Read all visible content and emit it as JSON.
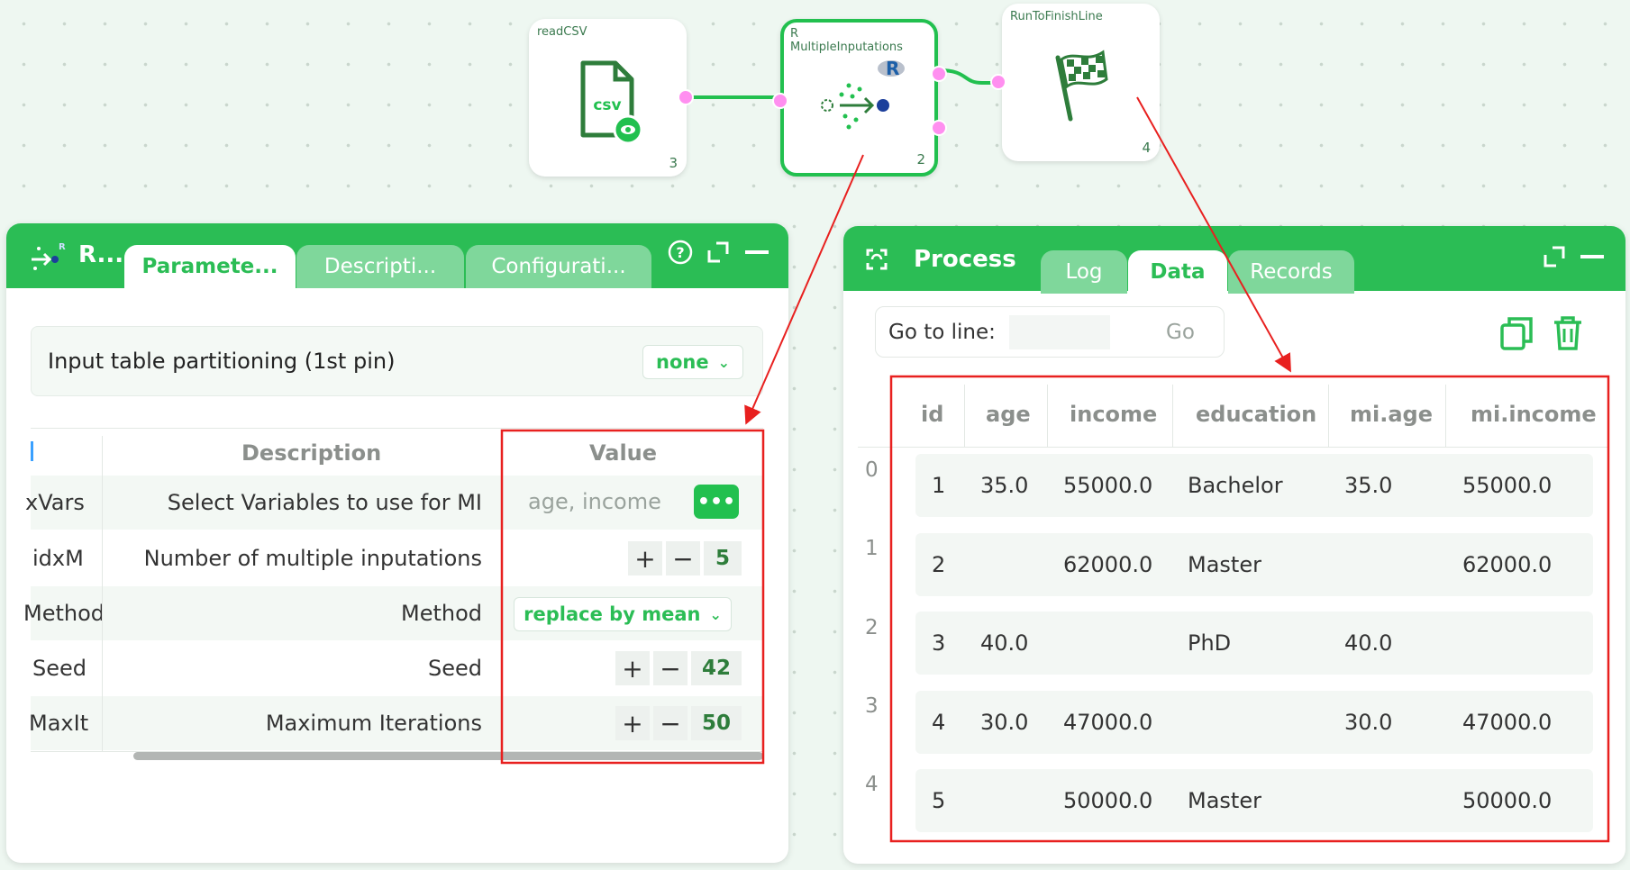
{
  "workflow": {
    "nodes": [
      {
        "title": "readCSV",
        "number": "3",
        "icon_label": "csv",
        "icon": "csv-file-icon"
      },
      {
        "title_line1": "R",
        "title_line2": "MultipleInputations",
        "number": "2",
        "badge": "R",
        "icon": "imputation-icon"
      },
      {
        "title": "RunToFinishLine",
        "number": "4",
        "icon": "checkered-flag-icon"
      }
    ]
  },
  "left_panel": {
    "title": "R...",
    "tabs": [
      {
        "label": "Paramete...",
        "active": true
      },
      {
        "label": "Descripti...",
        "active": false
      },
      {
        "label": "Configurati...",
        "active": false
      }
    ],
    "partition": {
      "label": "Input table partitioning (1st pin)",
      "value": "none"
    },
    "headers": {
      "description": "Description",
      "value": "Value"
    },
    "rows": [
      {
        "name": "xVars",
        "description": "Select Variables to use for MI",
        "value": "age, income",
        "control": "multiselect"
      },
      {
        "name": "idxM",
        "description": "Number of multiple inputations",
        "value": "5",
        "control": "stepper"
      },
      {
        "name": "Method",
        "description": "Method",
        "value": "replace by mean",
        "control": "select"
      },
      {
        "name": "Seed",
        "description": "Seed",
        "value": "42",
        "control": "stepper"
      },
      {
        "name": "MaxIt",
        "description": "Maximum Iterations",
        "value": "50",
        "control": "stepper"
      }
    ],
    "plus": "+",
    "minus": "−",
    "more": "•••"
  },
  "right_panel": {
    "title": "Process",
    "tabs": [
      {
        "label": "Log",
        "active": false
      },
      {
        "label": "Data",
        "active": true
      },
      {
        "label": "Records",
        "active": false
      }
    ],
    "goto": {
      "label": "Go to line:",
      "value": "",
      "button": "Go"
    },
    "columns": [
      "id",
      "age",
      "income",
      "education",
      "mi.age",
      "mi.income"
    ],
    "row_indices": [
      "0",
      "1",
      "2",
      "3",
      "4"
    ],
    "rows": [
      [
        "1",
        "35.0",
        "55000.0",
        "Bachelor",
        "35.0",
        "55000.0"
      ],
      [
        "2",
        "",
        "62000.0",
        "Master",
        "",
        "62000.0"
      ],
      [
        "3",
        "40.0",
        "",
        "PhD",
        "40.0",
        ""
      ],
      [
        "4",
        "30.0",
        "47000.0",
        "",
        "30.0",
        "47000.0"
      ],
      [
        "5",
        "",
        "50000.0",
        "Master",
        "",
        "50000.0"
      ]
    ]
  },
  "colors": {
    "accent": "#2bbd55",
    "annotation": "#e8201f",
    "pin": "#ff8ff0"
  }
}
